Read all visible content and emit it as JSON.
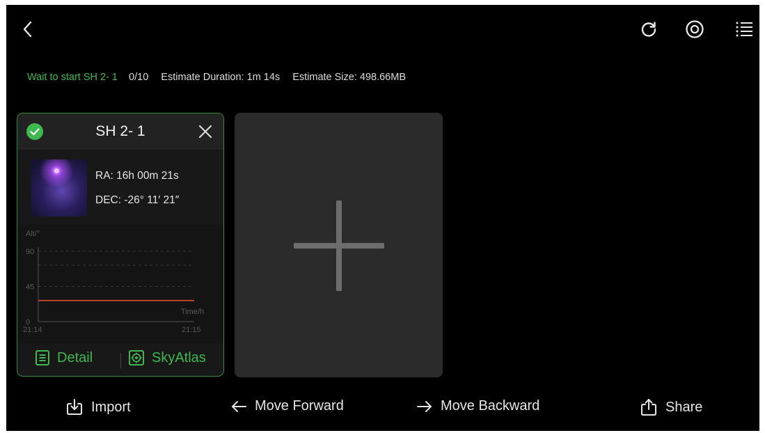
{
  "colors": {
    "accent": "#3fb850",
    "altitude_line": "#e0502a",
    "background": "#000000"
  },
  "header": {
    "back_icon": "chevron-left-icon",
    "right_icons": [
      "refresh-icon",
      "target-icon",
      "list-icon"
    ]
  },
  "status": {
    "state_text": "Wait to start SH 2- 1",
    "progress": "0/10",
    "duration": "Estimate Duration: 1m 14s",
    "size": "Estimate Size: 498.66MB"
  },
  "target_card": {
    "title": "SH 2- 1",
    "ra": "RA: 16h 00m 21s",
    "dec": "DEC: -26° 11′ 21″",
    "detail_label": "Detail",
    "skyatlas_label": "SkyAtlas"
  },
  "chart_data": {
    "type": "line",
    "ylabel": "Alt/°",
    "xlabel": "Time/h",
    "yticks": [
      "90",
      "45",
      "0"
    ],
    "xticks": [
      "21:14",
      "21:15"
    ],
    "ylim": [
      0,
      90
    ],
    "grid": true,
    "series": [
      {
        "x": [
          "21:14",
          "21:15"
        ],
        "values": [
          27,
          27
        ]
      }
    ]
  },
  "actions": {
    "import": "Import",
    "move_forward": "Move Forward",
    "move_backward": "Move Backward",
    "share": "Share"
  }
}
